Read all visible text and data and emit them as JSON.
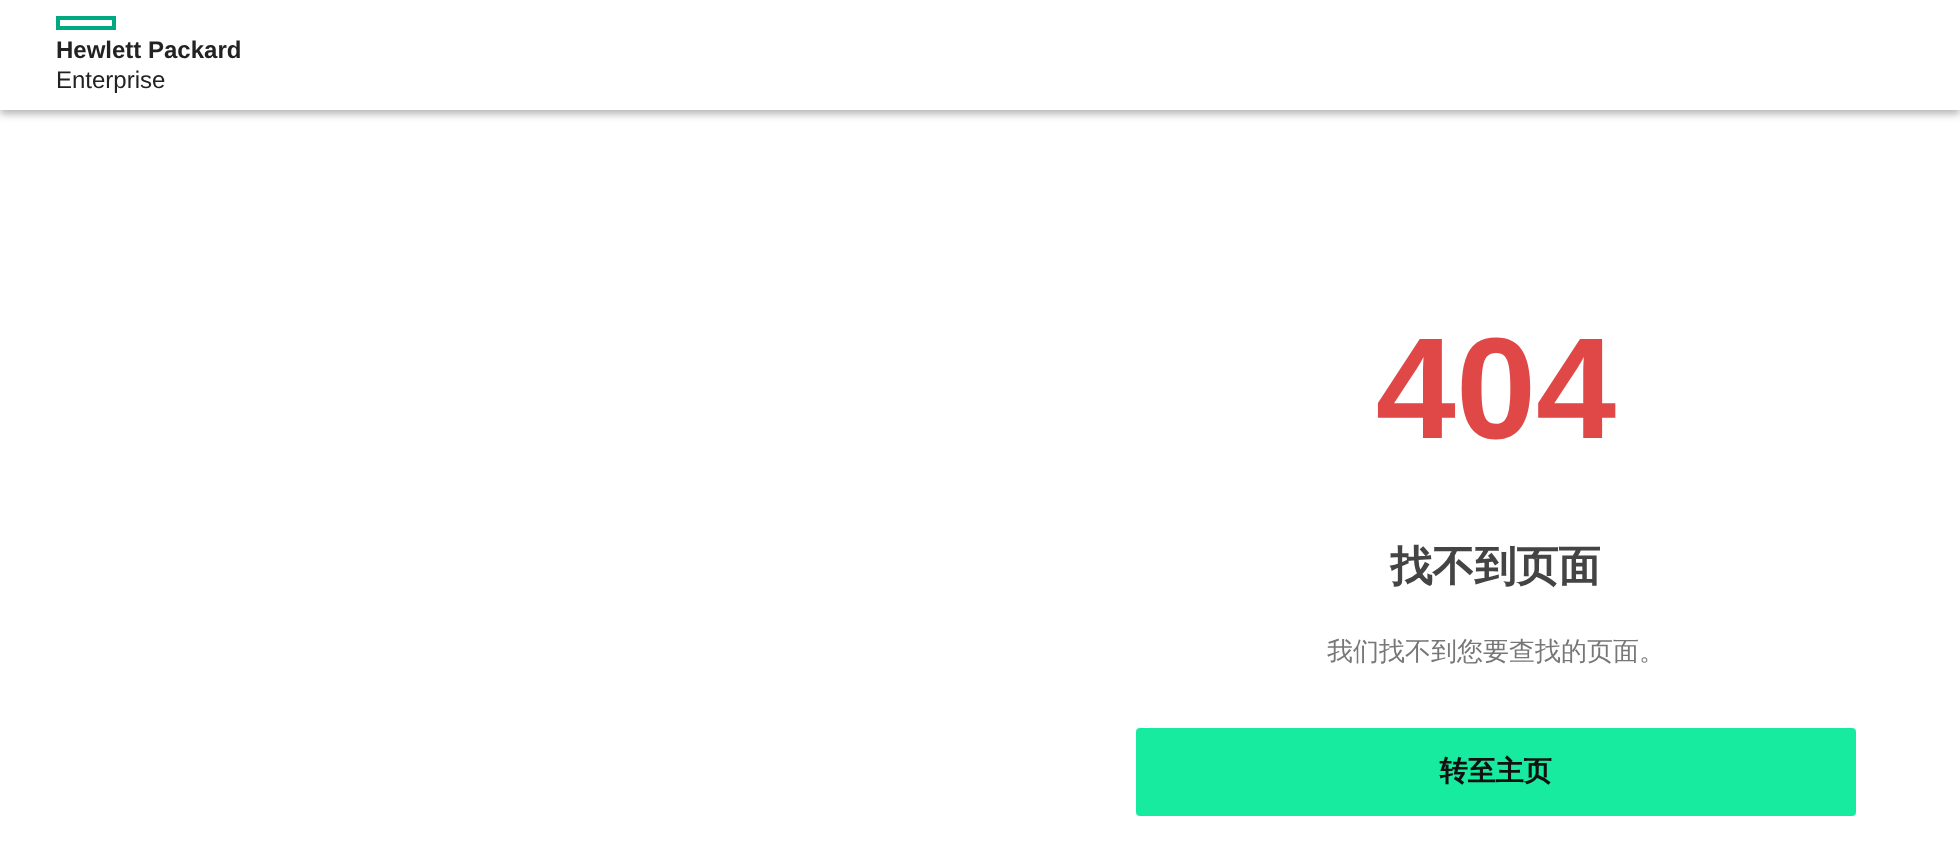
{
  "header": {
    "logo": {
      "line_1": "Hewlett Packard",
      "line_2": "Enterprise"
    }
  },
  "error": {
    "code": "404",
    "title": "找不到页面",
    "message": "我们找不到您要查找的页面。",
    "button": "转至主页"
  }
}
